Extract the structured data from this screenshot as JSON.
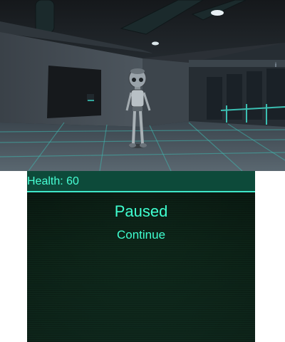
{
  "hud": {
    "health_label": "Health: 60",
    "health_value": 60
  },
  "pause_menu": {
    "title": "Paused",
    "continue_label": "Continue"
  },
  "colors": {
    "accent": "#3fffd0",
    "hud_bar": "#0d4a3a",
    "panel": "#0f2a1c"
  }
}
